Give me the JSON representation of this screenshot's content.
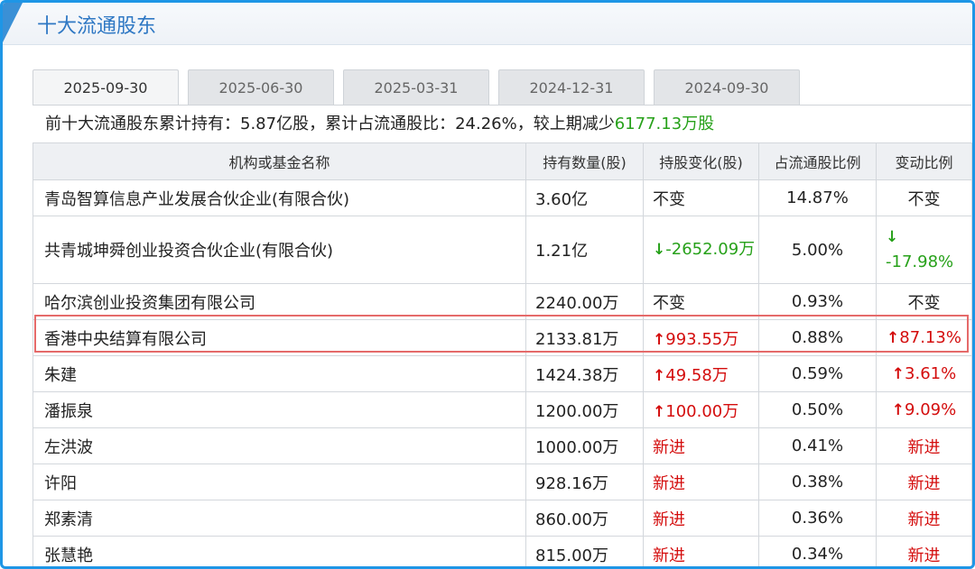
{
  "section_title": "十大流通股东",
  "tabs": [
    "2025-09-30",
    "2025-06-30",
    "2025-03-31",
    "2024-12-31",
    "2024-09-30"
  ],
  "active_tab": 0,
  "summary": {
    "prefix": "前十大流通股东累计持有：5.87亿股，累计占流通股比：24.26%，较上期减少",
    "change": "6177.13万股"
  },
  "columns": [
    "机构或基金名称",
    "持有数量(股)",
    "持股变化(股)",
    "占流通股比例",
    "变动比例"
  ],
  "rows": [
    {
      "name": "青岛智算信息产业发展合伙企业(有限合伙)",
      "hold": "3.60亿",
      "change": "不变",
      "change_dir": "none",
      "pct": "14.87%",
      "var": "不变",
      "var_dir": "none"
    },
    {
      "name": "共青城坤舜创业投资合伙企业(有限合伙)",
      "hold": "1.21亿",
      "change": "-2652.09万",
      "change_dir": "down",
      "pct": "5.00%",
      "var": "-17.98%",
      "var_dir": "down"
    },
    {
      "name": "哈尔滨创业投资集团有限公司",
      "hold": "2240.00万",
      "change": "不变",
      "change_dir": "none",
      "pct": "0.93%",
      "var": "不变",
      "var_dir": "none"
    },
    {
      "name": "香港中央结算有限公司",
      "hold": "2133.81万",
      "change": "993.55万",
      "change_dir": "up",
      "pct": "0.88%",
      "var": "87.13%",
      "var_dir": "up"
    },
    {
      "name": "朱建",
      "hold": "1424.38万",
      "change": "49.58万",
      "change_dir": "up",
      "pct": "0.59%",
      "var": "3.61%",
      "var_dir": "up"
    },
    {
      "name": "潘振泉",
      "hold": "1200.00万",
      "change": "100.00万",
      "change_dir": "up",
      "pct": "0.50%",
      "var": "9.09%",
      "var_dir": "up"
    },
    {
      "name": "左洪波",
      "hold": "1000.00万",
      "change": "新进",
      "change_dir": "new",
      "pct": "0.41%",
      "var": "新进",
      "var_dir": "new"
    },
    {
      "name": "许阳",
      "hold": "928.16万",
      "change": "新进",
      "change_dir": "new",
      "pct": "0.38%",
      "var": "新进",
      "var_dir": "new"
    },
    {
      "name": "郑素清",
      "hold": "860.00万",
      "change": "新进",
      "change_dir": "new",
      "pct": "0.36%",
      "var": "新进",
      "var_dir": "new"
    },
    {
      "name": "张慧艳",
      "hold": "815.00万",
      "change": "新进",
      "change_dir": "new",
      "pct": "0.34%",
      "var": "新进",
      "var_dir": "new"
    }
  ],
  "highlighted_row": 3,
  "colors": {
    "accent": "#1e96e6",
    "up": "#d40d0d",
    "down": "#27a11a",
    "highlight": "#e56a6a"
  },
  "icons": {
    "up": "arrow-up-icon",
    "down": "arrow-down-icon"
  }
}
